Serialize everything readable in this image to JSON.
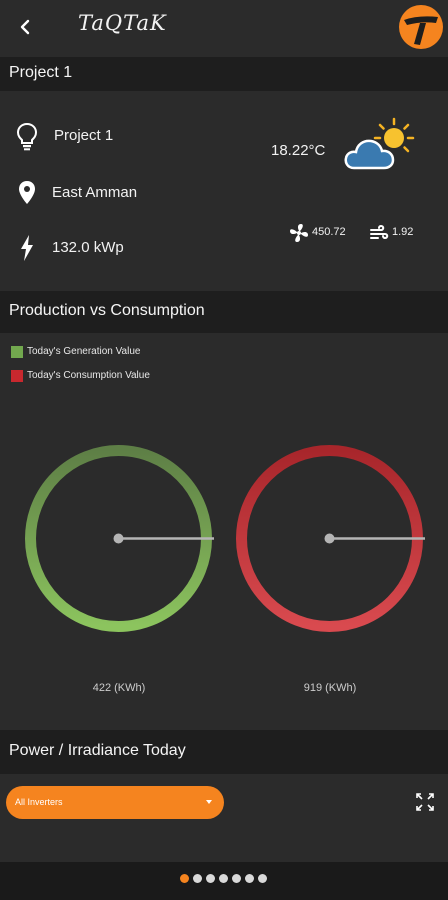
{
  "header": {
    "title": "TaQTaK",
    "back_icon": "chevron-left-icon",
    "logo_icon": "taqtak-logo-icon",
    "logo_color": "#f5841f"
  },
  "project_section": {
    "heading": "Project 1"
  },
  "project_info": {
    "name": "Project 1",
    "location": "East Amman",
    "capacity": "132.0 kWp",
    "temperature": "18.22°C",
    "weather_icon": "partly-cloudy-icon",
    "irradiance_value": "450.72",
    "wind_value": "1.92"
  },
  "production_section": {
    "heading": "Production vs Consumption",
    "legend": [
      {
        "label": "Today's Generation Value",
        "color": "#72a84e"
      },
      {
        "label": "Today's Consumption Value",
        "color": "#c8282e"
      }
    ],
    "generation": {
      "value_label": "422 (KWh)",
      "color": "#8cc45e"
    },
    "consumption": {
      "value_label": "919 (KWh)",
      "color": "#d94a4f"
    }
  },
  "power_section": {
    "heading": "Power / Irradiance Today",
    "dropdown_value": "All Inverters",
    "expand_icon": "fullscreen-icon"
  },
  "pager": {
    "count": 7,
    "active_index": 0,
    "accent": "#f5841f"
  }
}
